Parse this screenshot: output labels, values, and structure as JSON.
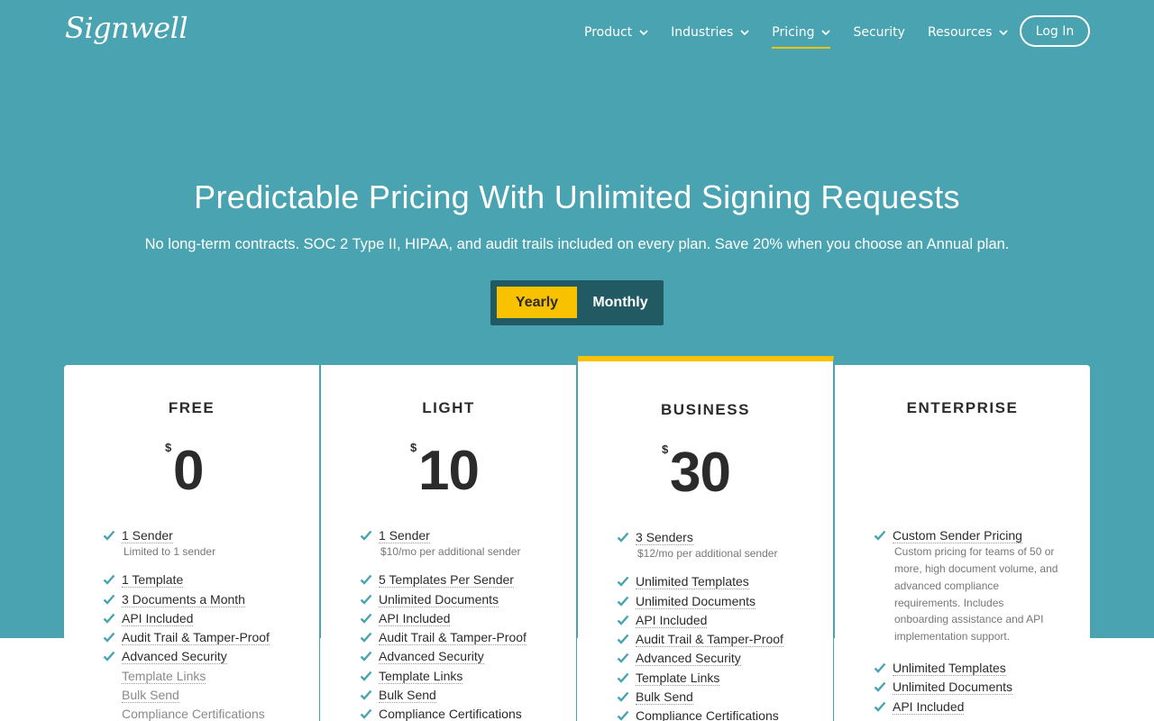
{
  "brand": {
    "logo_text": "Signwell"
  },
  "nav": {
    "items": [
      {
        "label": "Product",
        "has_dropdown": true,
        "active": false
      },
      {
        "label": "Industries",
        "has_dropdown": true,
        "active": false
      },
      {
        "label": "Pricing",
        "has_dropdown": true,
        "active": true
      },
      {
        "label": "Security",
        "has_dropdown": false,
        "active": false
      },
      {
        "label": "Resources",
        "has_dropdown": true,
        "active": false
      }
    ],
    "login_label": "Log In"
  },
  "hero": {
    "title": "Predictable Pricing With Unlimited Signing Requests",
    "subtitle": "No long-term contracts. SOC 2 Type II, HIPAA, and audit trails included on every plan. Save 20% when you choose an Annual plan."
  },
  "billing_toggle": {
    "yearly_label": "Yearly",
    "monthly_label": "Monthly",
    "selected": "Yearly"
  },
  "colors": {
    "hero_bg": "#4aa3b0",
    "accent": "#f9c200",
    "toggle_bg": "#215a63",
    "check": "#4aa3b0"
  },
  "plans": [
    {
      "name": "FREE",
      "currency": "$",
      "price": "0",
      "primary": {
        "label": "1 Sender",
        "note": "Limited to 1 sender"
      },
      "features": [
        {
          "label": "1 Template",
          "included": true
        },
        {
          "label": "3 Documents a Month",
          "included": true
        },
        {
          "label": "API Included",
          "included": true
        },
        {
          "label": "Audit Trail & Tamper-Proof",
          "included": true
        },
        {
          "label": "Advanced Security",
          "included": true
        },
        {
          "label": "Template Links",
          "included": false
        },
        {
          "label": "Bulk Send",
          "included": false
        },
        {
          "label": "Compliance Certifications",
          "included": false
        }
      ]
    },
    {
      "name": "LIGHT",
      "currency": "$",
      "price": "10",
      "primary": {
        "label": "1 Sender",
        "note": "$10/mo per additional sender"
      },
      "features": [
        {
          "label": "5 Templates Per Sender",
          "included": true
        },
        {
          "label": "Unlimited Documents",
          "included": true
        },
        {
          "label": "API Included",
          "included": true
        },
        {
          "label": "Audit Trail & Tamper-Proof",
          "included": true
        },
        {
          "label": "Advanced Security",
          "included": true
        },
        {
          "label": "Template Links",
          "included": true
        },
        {
          "label": "Bulk Send",
          "included": true
        },
        {
          "label": "Compliance Certifications",
          "included": true
        }
      ]
    },
    {
      "name": "BUSINESS",
      "currency": "$",
      "price": "30",
      "primary": {
        "label": "3 Senders",
        "note": "$12/mo per additional sender"
      },
      "features": [
        {
          "label": "Unlimited Templates",
          "included": true
        },
        {
          "label": "Unlimited Documents",
          "included": true
        },
        {
          "label": "API Included",
          "included": true
        },
        {
          "label": "Audit Trail & Tamper-Proof",
          "included": true
        },
        {
          "label": "Advanced Security",
          "included": true
        },
        {
          "label": "Template Links",
          "included": true
        },
        {
          "label": "Bulk Send",
          "included": true
        },
        {
          "label": "Compliance Certifications",
          "included": true
        }
      ]
    },
    {
      "name": "ENTERPRISE",
      "primary": {
        "label": "Custom Sender Pricing",
        "note": "Custom pricing for teams of 50 or more, high document volume, and advanced compliance requirements. Includes onboarding assistance and API implementation support."
      },
      "features": [
        {
          "label": "Unlimited Templates",
          "included": true
        },
        {
          "label": "Unlimited Documents",
          "included": true
        },
        {
          "label": "API Included",
          "included": true
        }
      ]
    }
  ]
}
